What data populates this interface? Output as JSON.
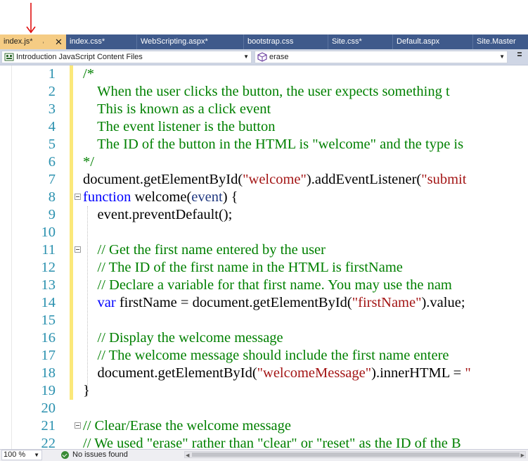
{
  "tabs": [
    {
      "label": "index.js*",
      "active": true
    },
    {
      "label": "index.css*",
      "active": false
    },
    {
      "label": "WebScripting.aspx*",
      "active": false
    },
    {
      "label": "bootstrap.css",
      "active": false
    },
    {
      "label": "Site.css*",
      "active": false
    },
    {
      "label": "Default.aspx",
      "active": false
    },
    {
      "label": "Site.Master",
      "active": false
    }
  ],
  "navbar": {
    "project": "Introduction JavaScript Content Files",
    "member": "erase"
  },
  "colors": {
    "tab_active": "#f5cc84",
    "tab_bar": "#3f5a8b",
    "comment": "#008000",
    "keyword": "#0000ff",
    "string": "#a31515",
    "line_number": "#2b91af",
    "change_marker": "#fbe87a",
    "arrow": "#e01010"
  },
  "editor": {
    "lines": [
      {
        "n": "1",
        "tokens": [
          [
            "cm",
            "/*"
          ]
        ]
      },
      {
        "n": "2",
        "tokens": [
          [
            "cm",
            "    When the user clicks the button, the user expects something t"
          ]
        ]
      },
      {
        "n": "3",
        "tokens": [
          [
            "cm",
            "    This is known as a click event"
          ]
        ]
      },
      {
        "n": "4",
        "tokens": [
          [
            "cm",
            "    The event listener is the button"
          ]
        ]
      },
      {
        "n": "5",
        "tokens": [
          [
            "cm",
            "    The ID of the button in the HTML is \"welcome\" and the type is"
          ]
        ]
      },
      {
        "n": "6",
        "tokens": [
          [
            "cm",
            "*/"
          ]
        ]
      },
      {
        "n": "7",
        "tokens": [
          [
            "pl",
            "document.getElementById("
          ],
          [
            "st",
            "\"welcome\""
          ],
          [
            "pl",
            ").addEventListener("
          ],
          [
            "st",
            "\"submit"
          ]
        ]
      },
      {
        "n": "8",
        "tokens": [
          [
            "kw",
            "function"
          ],
          [
            "pl",
            " welcome("
          ],
          [
            "pm",
            "event"
          ],
          [
            "pl",
            ") {"
          ]
        ]
      },
      {
        "n": "9",
        "tokens": [
          [
            "pl",
            "    event.preventDefault();"
          ]
        ]
      },
      {
        "n": "10",
        "tokens": []
      },
      {
        "n": "11",
        "tokens": [
          [
            "cm",
            "    // Get the first name entered by the user"
          ]
        ]
      },
      {
        "n": "12",
        "tokens": [
          [
            "cm",
            "    // The ID of the first name in the HTML is firstName"
          ]
        ]
      },
      {
        "n": "13",
        "tokens": [
          [
            "cm",
            "    // Declare a variable for that first name. You may use the nam"
          ]
        ]
      },
      {
        "n": "14",
        "tokens": [
          [
            "pl",
            "    "
          ],
          [
            "kw",
            "var"
          ],
          [
            "pl",
            " firstName = document.getElementById("
          ],
          [
            "st",
            "\"firstName\""
          ],
          [
            "pl",
            ").value;"
          ]
        ]
      },
      {
        "n": "15",
        "tokens": []
      },
      {
        "n": "16",
        "tokens": [
          [
            "cm",
            "    // Display the welcome message"
          ]
        ]
      },
      {
        "n": "17",
        "tokens": [
          [
            "cm",
            "    // The welcome message should include the first name entere"
          ]
        ]
      },
      {
        "n": "18",
        "tokens": [
          [
            "pl",
            "    document.getElementById("
          ],
          [
            "st",
            "\"welcomeMessage\""
          ],
          [
            "pl",
            ").innerHTML = "
          ],
          [
            "st",
            "\""
          ]
        ]
      },
      {
        "n": "19",
        "tokens": [
          [
            "pl",
            "}"
          ]
        ]
      },
      {
        "n": "20",
        "tokens": []
      },
      {
        "n": "21",
        "tokens": [
          [
            "cm",
            "// Clear/Erase the welcome message"
          ]
        ]
      },
      {
        "n": "22",
        "tokens": [
          [
            "cm",
            "// We used \"erase\" rather than \"clear\" or \"reset\" as the ID of the B"
          ]
        ]
      }
    ]
  },
  "statusbar": {
    "zoom": "100 %",
    "issues": "No issues found"
  }
}
